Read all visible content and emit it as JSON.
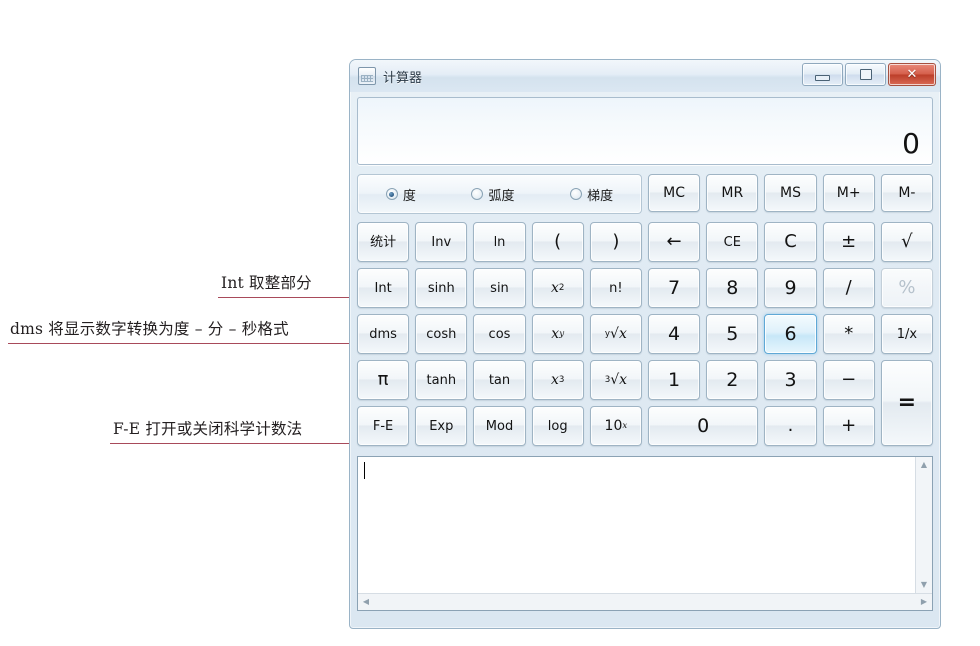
{
  "page": {
    "background": "#ffffff",
    "accent_blue": "#2c5a84",
    "annotation_color": "#a84a5a"
  },
  "annotations": [
    {
      "id": "int",
      "text": "Int 取整部分"
    },
    {
      "id": "dms",
      "text": "dms 将显示数字转换为度 – 分 – 秒格式"
    },
    {
      "id": "fe",
      "text": "F-E 打开或关闭科学计数法"
    }
  ],
  "window": {
    "title": "计算器",
    "icon": "calculator-icon",
    "controls": [
      {
        "name": "minimize",
        "glyph": "minimize-icon"
      },
      {
        "name": "maximize",
        "glyph": "maximize-icon"
      },
      {
        "name": "close",
        "glyph": "✕"
      }
    ]
  },
  "display": {
    "value": "0"
  },
  "modes": {
    "options": [
      {
        "label": "度",
        "checked": true
      },
      {
        "label": "弧度",
        "checked": false
      },
      {
        "label": "梯度",
        "checked": false
      }
    ]
  },
  "memory_buttons": [
    {
      "label": "MC"
    },
    {
      "label": "MR"
    },
    {
      "label": "MS"
    },
    {
      "label": "M+"
    },
    {
      "label": "M-"
    }
  ],
  "keypad": {
    "rows": [
      [
        {
          "label": "统计",
          "style": "cjk"
        },
        {
          "label": "Inv",
          "style": "small"
        },
        {
          "label": "ln",
          "style": "small"
        },
        {
          "label": "(",
          "style": "op"
        },
        {
          "label": ")",
          "style": "op"
        },
        {
          "label": "←",
          "style": "op"
        },
        {
          "label": "CE",
          "style": "small"
        },
        {
          "label": "C",
          "style": "op"
        },
        {
          "label": "±",
          "style": "op"
        },
        {
          "label": "√",
          "style": "op"
        }
      ],
      [
        {
          "label": "Int",
          "style": "small"
        },
        {
          "label": "sinh",
          "style": "small"
        },
        {
          "label": "sin",
          "style": "small"
        },
        {
          "label": "x²",
          "style": "sup",
          "base": "x",
          "exp": "2"
        },
        {
          "label": "n!",
          "style": "small"
        },
        {
          "label": "7",
          "style": "num"
        },
        {
          "label": "8",
          "style": "num"
        },
        {
          "label": "9",
          "style": "num"
        },
        {
          "label": "/",
          "style": "op"
        },
        {
          "label": "%",
          "style": "op",
          "disabled": true
        }
      ],
      [
        {
          "label": "dms",
          "style": "small"
        },
        {
          "label": "cosh",
          "style": "small"
        },
        {
          "label": "cos",
          "style": "small"
        },
        {
          "label": "xʸ",
          "style": "sup",
          "base": "x",
          "exp": "y"
        },
        {
          "label": "ʸ√x",
          "style": "root",
          "index": "y"
        },
        {
          "label": "4",
          "style": "num"
        },
        {
          "label": "5",
          "style": "num"
        },
        {
          "label": "6",
          "style": "num",
          "hover": true
        },
        {
          "label": "*",
          "style": "op"
        },
        {
          "label": "1/x",
          "style": "small"
        }
      ],
      [
        {
          "label": "π",
          "style": "op"
        },
        {
          "label": "tanh",
          "style": "small"
        },
        {
          "label": "tan",
          "style": "small"
        },
        {
          "label": "x³",
          "style": "sup",
          "base": "x",
          "exp": "3"
        },
        {
          "label": "³√x",
          "style": "root",
          "index": "3"
        },
        {
          "label": "1",
          "style": "num"
        },
        {
          "label": "2",
          "style": "num"
        },
        {
          "label": "3",
          "style": "num"
        },
        {
          "label": "−",
          "style": "op"
        },
        {
          "label": "=",
          "style": "equals",
          "tall": true
        }
      ],
      [
        {
          "label": "F-E",
          "style": "small"
        },
        {
          "label": "Exp",
          "style": "small"
        },
        {
          "label": "Mod",
          "style": "small"
        },
        {
          "label": "log",
          "style": "small"
        },
        {
          "label": "10ˣ",
          "style": "sup",
          "base": "10",
          "exp": "x"
        },
        {
          "label": "0",
          "style": "num",
          "wide": true
        },
        {
          "label": ".",
          "style": "op"
        },
        {
          "label": "+",
          "style": "op"
        }
      ]
    ]
  },
  "history": {
    "text": "",
    "has_caret": true,
    "vertical_scrollbar": {
      "up": "▲",
      "down": "▼"
    },
    "horizontal_scrollbar": {
      "left": "◀",
      "right": "▶"
    }
  }
}
